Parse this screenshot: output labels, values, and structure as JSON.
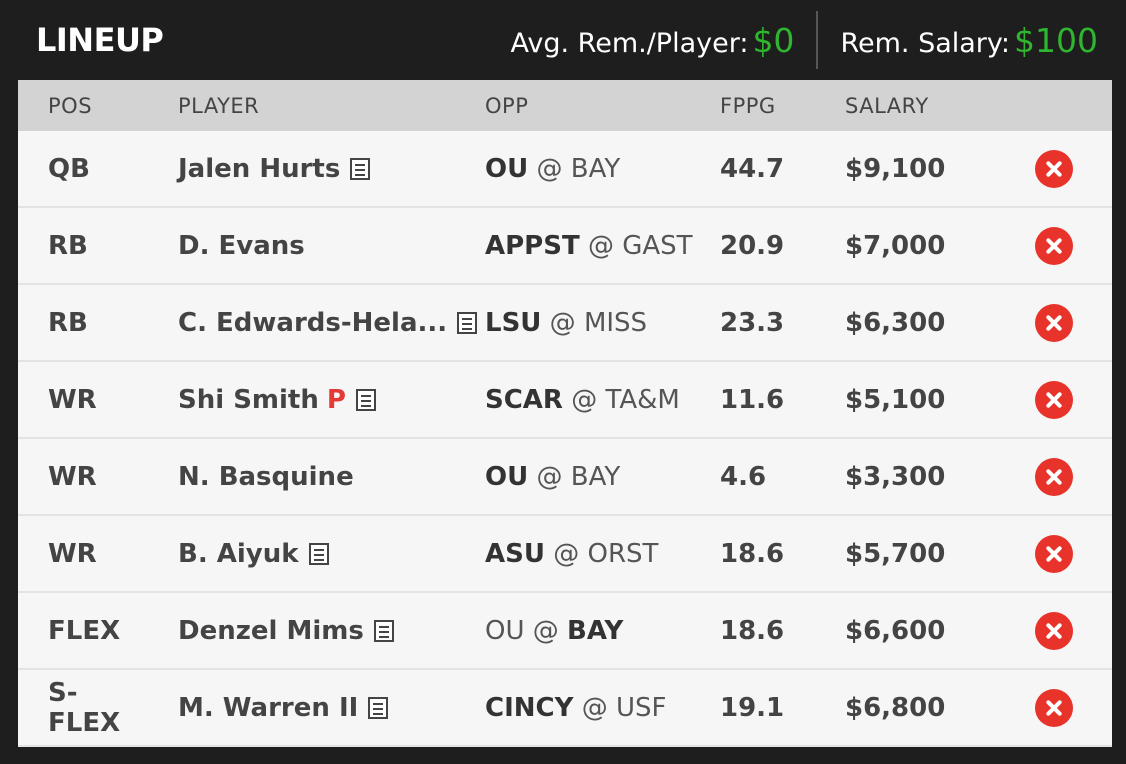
{
  "header": {
    "title": "LINEUP",
    "avg_label": "Avg. Rem./Player:",
    "avg_value": "$0",
    "rem_label": "Rem. Salary:",
    "rem_value": "$100",
    "accent_color": "#2fb52f"
  },
  "columns": [
    "POS",
    "PLAYER",
    "OPP",
    "FPPG",
    "SALARY"
  ],
  "rows": [
    {
      "pos": "QB",
      "player": "Jalen Hurts",
      "news": true,
      "tag": "",
      "away": "OU",
      "home": "BAY",
      "bold": "away",
      "fppg": "44.7",
      "salary": "$9,100"
    },
    {
      "pos": "RB",
      "player": "D. Evans",
      "news": false,
      "tag": "",
      "away": "APPST",
      "home": "GAST",
      "bold": "away",
      "fppg": "20.9",
      "salary": "$7,000"
    },
    {
      "pos": "RB",
      "player": "C. Edwards-Hela...",
      "news": true,
      "tag": "",
      "away": "LSU",
      "home": "MISS",
      "bold": "away",
      "fppg": "23.3",
      "salary": "$6,300"
    },
    {
      "pos": "WR",
      "player": "Shi Smith",
      "news": true,
      "tag": "P",
      "away": "SCAR",
      "home": "TA&M",
      "bold": "away",
      "fppg": "11.6",
      "salary": "$5,100"
    },
    {
      "pos": "WR",
      "player": "N. Basquine",
      "news": false,
      "tag": "",
      "away": "OU",
      "home": "BAY",
      "bold": "away",
      "fppg": "4.6",
      "salary": "$3,300"
    },
    {
      "pos": "WR",
      "player": "B. Aiyuk",
      "news": true,
      "tag": "",
      "away": "ASU",
      "home": "ORST",
      "bold": "away",
      "fppg": "18.6",
      "salary": "$5,700"
    },
    {
      "pos": "FLEX",
      "player": "Denzel Mims",
      "news": true,
      "tag": "",
      "away": "OU",
      "home": "BAY",
      "bold": "home",
      "fppg": "18.6",
      "salary": "$6,600"
    },
    {
      "pos": "S-FLEX",
      "player": "M. Warren II",
      "news": true,
      "tag": "",
      "away": "CINCY",
      "home": "USF",
      "bold": "away",
      "fppg": "19.1",
      "salary": "$6,800"
    }
  ],
  "icons": {
    "news": "news-icon",
    "remove": "remove-icon"
  },
  "colors": {
    "remove": "#e8332b",
    "tag": "#e53935"
  }
}
